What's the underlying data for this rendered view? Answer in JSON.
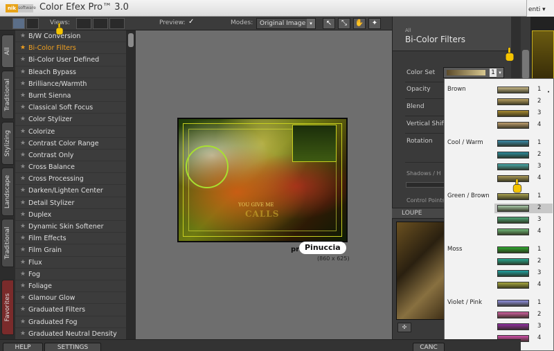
{
  "titlebar": {
    "logo_text": "nik",
    "logo_sub": "software",
    "title": "Color Efex Pro™ 3.0"
  },
  "browser_fragment": {
    "text": "enti ▾"
  },
  "toolbar": {
    "views_label": "Views:",
    "preview_label": "Preview:",
    "preview_checked": "✓",
    "modes_label": "Modes:",
    "modes_value": "Original Image"
  },
  "side_tabs": [
    "All",
    "Traditional",
    "Stylizing",
    "Landscape",
    "Traditional",
    "Favorites"
  ],
  "filters": [
    "B/W Conversion",
    "Bi-Color Filters",
    "Bi-Color User Defined",
    "Bleach Bypass",
    "Brilliance/Warmth",
    "Burnt Sienna",
    "Classical Soft Focus",
    "Color Stylizer",
    "Colorize",
    "Contrast Color Range",
    "Contrast Only",
    "Cross Balance",
    "Cross Processing",
    "Darken/Lighten Center",
    "Detail Stylizer",
    "Duplex",
    "Dynamic Skin Softener",
    "Film Effects",
    "Film Grain",
    "Flux",
    "Fog",
    "Foliage",
    "Glamour Glow",
    "Graduated Filters",
    "Graduated Fog",
    "Graduated Neutral Density"
  ],
  "active_filter_index": 1,
  "preview": {
    "art_text_small": "YOU GIVE ME",
    "art_text_large": "CALLS",
    "watermark": "Pinuccia",
    "pr_fragment": "pr",
    "dimensions": "(860 x 625)"
  },
  "right_panel": {
    "category": "All",
    "filter_title": "Bi-Color Filters",
    "params": [
      "Color Set",
      "Opacity",
      "Blend",
      "Vertical Shift",
      "Rotation"
    ],
    "color_set_value": "1",
    "shadows_label": "Shadows / H",
    "control_points_label": "Control Points",
    "loupe_label": "LOUPE"
  },
  "color_set_popup": {
    "groups": [
      {
        "name": "Brown",
        "colors": [
          "#c8b888",
          "#b8a060",
          "#a88a30",
          "#c0a070"
        ]
      },
      {
        "name": "Cool / Warm",
        "colors": [
          "#3a8aa8",
          "#2a8a9a",
          "#48a8a8",
          "#a89858"
        ]
      },
      {
        "name": "Green / Brown",
        "colors": [
          "#a8a050",
          "#a8c8a8",
          "#50a878",
          "#70b878"
        ]
      },
      {
        "name": "Moss",
        "colors": [
          "#30a830",
          "#28a890",
          "#20a0a0",
          "#a8a840"
        ]
      },
      {
        "name": "Violet / Pink",
        "colors": [
          "#9090e0",
          "#d060a0",
          "#9030a0",
          "#d050a8"
        ]
      }
    ],
    "numbers": [
      "1",
      "2",
      "3",
      "4"
    ],
    "selected_group": 2,
    "selected_index": 1,
    "current_marker": "•"
  },
  "bottom_bar": {
    "help": "HELP",
    "settings": "SETTINGS",
    "cancel": "CANC"
  }
}
